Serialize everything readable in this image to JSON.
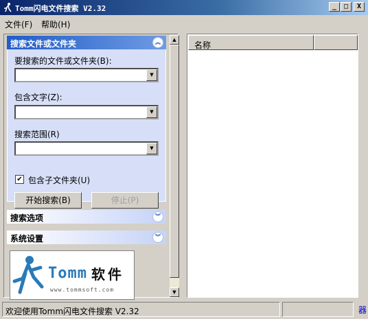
{
  "window": {
    "title": "Tomm闪电文件搜索 V2.32",
    "min_glyph": "_",
    "max_glyph": "□",
    "close_glyph": "X"
  },
  "menu": [
    "文件(F)",
    "帮助(H)"
  ],
  "search_group": {
    "header": "搜索文件或文件夹",
    "collapse_glyph": "︽",
    "name_label": "要搜索的文件或文件夹(B):",
    "name_value": "",
    "text_label": "包含文字(Z):",
    "text_value": "",
    "scope_label": "搜索范围(R)",
    "scope_value": "",
    "include_subfolders_label": "包含子文件夹(U)",
    "include_subfolders_checked": true,
    "check_glyph": "✔",
    "start_button": "开始搜索(B)",
    "stop_button": "停止(P)"
  },
  "options_group": {
    "header": "搜索选项",
    "expand_glyph": "︾"
  },
  "settings_group": {
    "header": "系统设置",
    "expand_glyph": "︾"
  },
  "logo": {
    "brand": "Tomm",
    "suffix": "软件",
    "url": "www.tommsoft.com"
  },
  "results": {
    "columns": [
      "名称",
      ""
    ],
    "rows": []
  },
  "status": {
    "message": "欢迎使用Tomm闪电文件搜索 V2.32",
    "right": "",
    "icon_glyph": "器"
  },
  "colors": {
    "title_start": "#0a246a",
    "group_header": "#215dc6",
    "face": "#d4d0c8"
  }
}
